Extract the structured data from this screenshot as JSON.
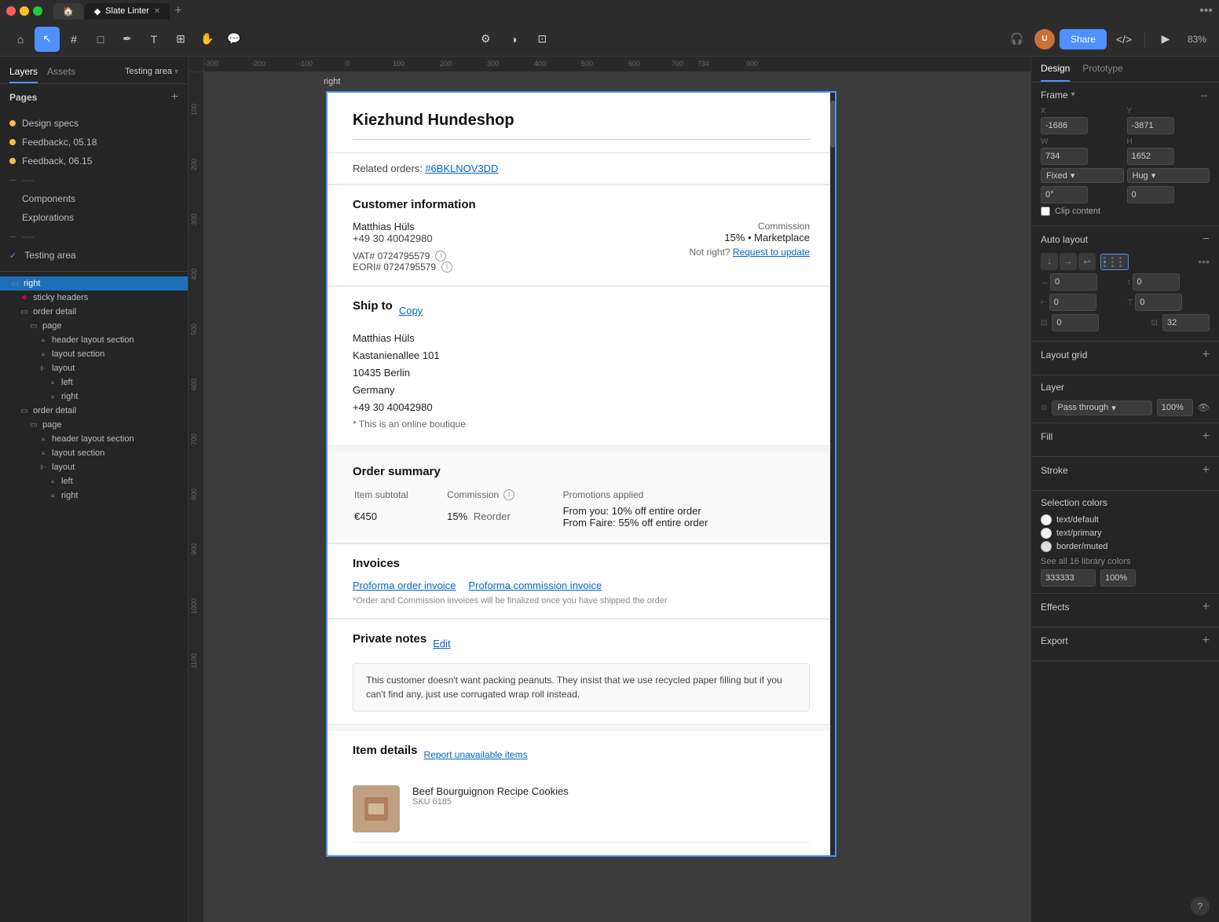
{
  "app": {
    "title": "Slate Linter",
    "zoom": "83%",
    "tab_label": "Slate Linter"
  },
  "toolbar": {
    "tools": [
      "home",
      "cursor",
      "frame",
      "shape",
      "pen",
      "text",
      "component",
      "hand",
      "comment"
    ],
    "center_tools": [
      "plugins",
      "contrast",
      "layers"
    ],
    "share_label": "Share",
    "avatar_initials": "U"
  },
  "left_panel": {
    "layers_tab": "Layers",
    "assets_tab": "Assets",
    "breadcrumb": "Testing area",
    "pages_header": "Pages",
    "pages": [
      {
        "label": "Design specs",
        "dot": "yellow",
        "id": "design-specs"
      },
      {
        "label": "Feedbackc, 05.18",
        "dot": "yellow",
        "id": "feedback-1"
      },
      {
        "label": "Feedback, 06.15",
        "dot": "yellow",
        "id": "feedback-2"
      },
      {
        "label": "----",
        "dot": "dash",
        "id": "separator-1"
      },
      {
        "label": "Components",
        "dot": "none",
        "id": "components"
      },
      {
        "label": "Explorations",
        "dot": "none",
        "id": "explorations"
      },
      {
        "label": "----",
        "dot": "dash",
        "id": "separator-2"
      },
      {
        "label": "Testing area",
        "dot": "none",
        "id": "testing-area",
        "checkmark": true
      }
    ],
    "layers": [
      {
        "label": "right",
        "indent": 0,
        "icon": "frame",
        "selected": true
      },
      {
        "label": "sticky headers",
        "indent": 1,
        "icon": "component",
        "red": true
      },
      {
        "label": "order detail",
        "indent": 1,
        "icon": "frame"
      },
      {
        "label": "page",
        "indent": 2,
        "icon": "frame"
      },
      {
        "label": "header layout section",
        "indent": 3,
        "icon": "layout"
      },
      {
        "label": "layout section",
        "indent": 3,
        "icon": "layout"
      },
      {
        "label": "layout",
        "indent": 4,
        "icon": "layout2"
      },
      {
        "label": "left",
        "indent": 5,
        "icon": "layout"
      },
      {
        "label": "right",
        "indent": 5,
        "icon": "layout"
      },
      {
        "label": "order detail",
        "indent": 1,
        "icon": "frame"
      },
      {
        "label": "page",
        "indent": 2,
        "icon": "frame"
      },
      {
        "label": "header layout section",
        "indent": 3,
        "icon": "layout"
      },
      {
        "label": "layout section",
        "indent": 3,
        "icon": "layout"
      },
      {
        "label": "layout",
        "indent": 4,
        "icon": "layout2"
      },
      {
        "label": "left",
        "indent": 5,
        "icon": "layout"
      },
      {
        "label": "right",
        "indent": 5,
        "icon": "layout"
      }
    ]
  },
  "canvas": {
    "frame_label": "right",
    "ruler_marks": [
      "-300",
      "-200",
      "-100",
      "0",
      "100",
      "200",
      "300",
      "400",
      "500",
      "600",
      "700",
      "734",
      "900"
    ]
  },
  "design_content": {
    "title": "Kiezhund Hundeshop",
    "related_orders_label": "Related orders:",
    "related_orders_link": "#6BKLNOV3DD",
    "customer_info_title": "Customer information",
    "customer_name": "Matthias Hüls",
    "customer_phone": "+49 30 40042980",
    "commission_label": "Commission",
    "commission_value": "15% • Marketplace",
    "not_right_label": "Not right?",
    "request_update_link": "Request to update",
    "vat_label": "VAT# 0724795579",
    "eori_label": "EORI# 0724795579",
    "ship_to_title": "Ship to",
    "copy_label": "Copy",
    "ship_name": "Matthias Hüls",
    "ship_address1": "Kastanienallee 101",
    "ship_city": "10435 Berlin",
    "ship_country": "Germany",
    "ship_phone": "+49 30 40042980",
    "ship_note": "* This is an online boutique",
    "order_summary_title": "Order summary",
    "col_item_subtotal": "Item subtotal",
    "col_commission": "Commission",
    "col_promotions": "Promotions applied",
    "val_subtotal": "€450",
    "val_commission_pct": "15%",
    "val_commission_type": "Reorder",
    "promo_from_you": "From you:  10% off entire order",
    "promo_from_faire": "From Faire:  55% off entire order",
    "invoices_title": "Invoices",
    "invoice_proforma_link": "Proforma order invoice",
    "invoice_commission_link": "Proforma commission invoice",
    "invoice_note": "*Order and Commission invoices will be finalized once you have shipped the order",
    "private_notes_title": "Private notes",
    "edit_label": "Edit",
    "private_note_text": "This customer doesn't want packing peanuts. They insist that we use recycled paper filling but if you can't find any, just use corrugated wrap roll instead.",
    "item_details_title": "Item details",
    "report_link": "Report unavailable items",
    "item_name": "Beef Bourguignon Recipe Cookies",
    "item_sku": "SKU 6185"
  },
  "right_panel": {
    "design_tab": "Design",
    "prototype_tab": "Prototype",
    "frame_section": {
      "title": "Frame",
      "x_label": "X",
      "x_value": "-1686",
      "y_label": "Y",
      "y_value": "-3871",
      "w_label": "W",
      "w_value": "734",
      "h_label": "H",
      "h_value": "1652",
      "fixed_label": "Fixed",
      "hug_label": "Hug",
      "rotation_label": "0°",
      "corner_label": "0"
    },
    "clip_content_label": "Clip content",
    "auto_layout_section": {
      "title": "Auto layout",
      "spacing_0": "0",
      "spacing_1": "0",
      "spacing_2": "0",
      "spacing_3": "32",
      "spacing_4": "0"
    },
    "layout_grid_section": {
      "title": "Layout grid"
    },
    "layer_section": {
      "title": "Layer",
      "blend_mode": "Pass through",
      "opacity": "100%"
    },
    "fill_section": {
      "title": "Fill"
    },
    "stroke_section": {
      "title": "Stroke"
    },
    "selection_colors": {
      "title": "Selection colors",
      "colors": [
        {
          "name": "text/default",
          "swatch": "#333333",
          "type": "circle"
        },
        {
          "name": "text/primary",
          "swatch": "#1a1a1a",
          "type": "circle"
        },
        {
          "name": "border/muted",
          "swatch": "#e0e0e0",
          "type": "filled-circle"
        }
      ],
      "see_all_link": "See all 16 library colors",
      "hex_value": "333333",
      "opacity_value": "100%"
    },
    "effects_section": {
      "title": "Effects"
    },
    "export_section": {
      "title": "Export"
    }
  }
}
